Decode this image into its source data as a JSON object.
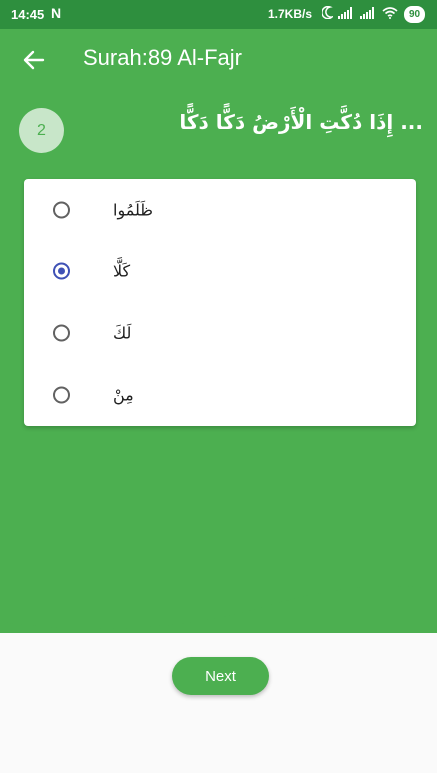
{
  "status_bar": {
    "time": "14:45",
    "notification_glyph": "N",
    "network_speed": "1.7KB/s",
    "battery": "90",
    "icons": [
      "moon-icon",
      "signal-icon",
      "signal-icon",
      "wifi-icon",
      "battery-icon"
    ]
  },
  "app_bar": {
    "back_icon": "arrow-left-icon",
    "title": "Surah:89 Al-Fajr"
  },
  "question": {
    "number": "2",
    "text": "... إِذَا دُكَّتِ الْأَرْضُ دَكًّا دَكًّا"
  },
  "options": [
    {
      "label": "ظَلَمُوا",
      "selected": false
    },
    {
      "label": "كَلَّا",
      "selected": true
    },
    {
      "label": "لَكَ",
      "selected": false
    },
    {
      "label": "مِنْ",
      "selected": false
    }
  ],
  "next_button": {
    "label": "Next"
  },
  "colors": {
    "primary_green": "#4caf50",
    "status_bar_green": "#2e8f3e",
    "badge_bg": "#c8e6c9",
    "radio_selected": "#3f51b5",
    "background": "#fafafa"
  }
}
